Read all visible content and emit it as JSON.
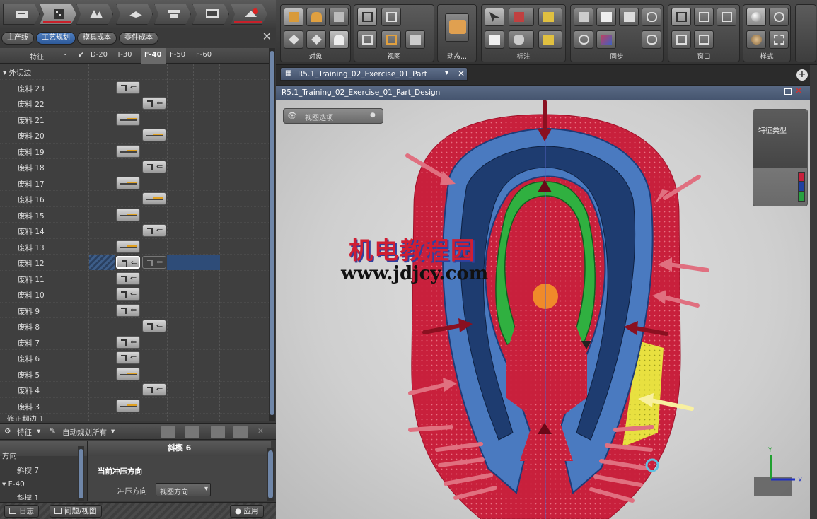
{
  "left_panel": {
    "nav_buttons": [
      "part-icon",
      "process-plan-icon",
      "forming-icon",
      "trim-icon",
      "press-icon",
      "report-icon",
      "mesh-icon"
    ],
    "tabs": [
      "主产线",
      "工艺规划",
      "模具成本",
      "零件成本"
    ],
    "active_tab": "工艺规划",
    "columns": {
      "feature": "特征",
      "d20": "D-20",
      "t30": "T-30",
      "f40": "F-40",
      "f50": "F-50",
      "f60": "F-60"
    },
    "group": "外切边",
    "rows": [
      {
        "label": "废料 23",
        "col": "T-30",
        "icon": "hook"
      },
      {
        "label": "废料 22",
        "col": "F-40",
        "icon": "hook"
      },
      {
        "label": "废料 21",
        "col": "T-30",
        "icon": "flat"
      },
      {
        "label": "废料 20",
        "col": "F-40",
        "icon": "flat"
      },
      {
        "label": "废料 19",
        "col": "T-30",
        "icon": "flat"
      },
      {
        "label": "废料 18",
        "col": "F-40",
        "icon": "hook"
      },
      {
        "label": "废料 17",
        "col": "T-30",
        "icon": "flat"
      },
      {
        "label": "废料 16",
        "col": "F-40",
        "icon": "flat"
      },
      {
        "label": "废料 15",
        "col": "T-30",
        "icon": "flat"
      },
      {
        "label": "废料 14",
        "col": "F-40",
        "icon": "hook"
      },
      {
        "label": "废料 13",
        "col": "T-30",
        "icon": "flat"
      },
      {
        "label": "废料 12",
        "col": "T-30",
        "icon": "hook"
      },
      {
        "label": "废料 11",
        "col": "T-30",
        "icon": "hook"
      },
      {
        "label": "废料 10",
        "col": "T-30",
        "icon": "hook"
      },
      {
        "label": "废料 9",
        "col": "T-30",
        "icon": "hook"
      },
      {
        "label": "废料 8",
        "col": "F-40",
        "icon": "hook"
      },
      {
        "label": "废料 7",
        "col": "T-30",
        "icon": "hook"
      },
      {
        "label": "废料 6",
        "col": "T-30",
        "icon": "hook"
      },
      {
        "label": "废料 5",
        "col": "T-30",
        "icon": "flat"
      },
      {
        "label": "废料 4",
        "col": "F-40",
        "icon": "hook"
      },
      {
        "label": "废料 3",
        "col": "T-30",
        "icon": "flat"
      }
    ],
    "cut_row_label": "修正翻边 1",
    "panel_toolbar": {
      "feature_dropdown": "特征",
      "auto_plan": "自动规划所有"
    },
    "direction_panel": {
      "header": "方向",
      "items": [
        "斜楔 7",
        "F-40",
        "斜楔 1"
      ]
    },
    "detail_panel": {
      "title": "斜楔 6",
      "section": "当前冲压方向",
      "field_label": "冲压方向",
      "field_value": "视图方向"
    },
    "status": {
      "log": "日志",
      "issues": "问题/视图",
      "apply": "应用"
    }
  },
  "ribbon": {
    "groups": [
      "对象",
      "视图",
      "动态...",
      "标注",
      "同步",
      "窗口",
      "样式"
    ]
  },
  "viewport": {
    "doc_tab": "R5.1_Training_02_Exercise_01_Part",
    "title": "R5.1_Training_02_Exercise_01_Part_Design",
    "view_options": "视图选项",
    "feature_type": "特征类型",
    "legend_colors": [
      "#c8203c",
      "#2040a0",
      "#28a040"
    ],
    "watermark_cn": "机电教程园",
    "watermark_url": "www.jdjcy.com"
  }
}
